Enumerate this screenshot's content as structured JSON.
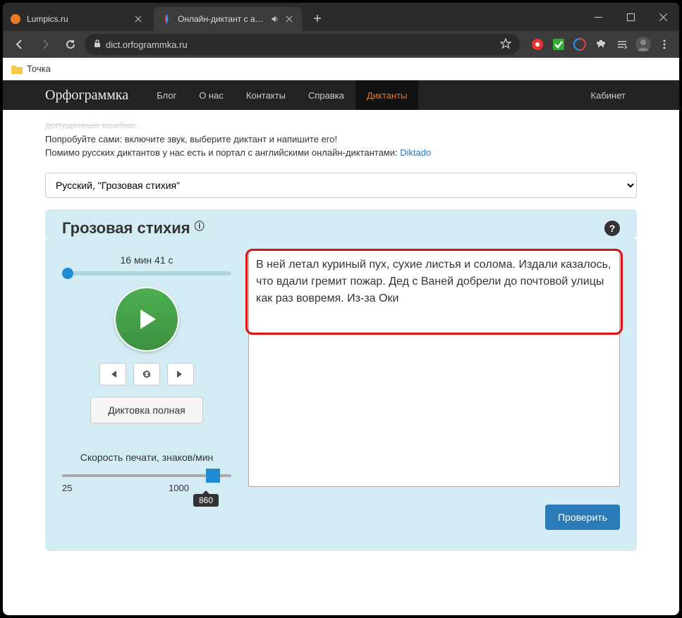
{
  "browser": {
    "tabs": [
      {
        "title": "Lumpics.ru",
        "active": false
      },
      {
        "title": "Онлайн-диктант с автомати",
        "active": true,
        "audio": true
      }
    ],
    "url": "dict.orfogrammka.ru",
    "bookmarks": [
      {
        "name": "Точка"
      }
    ]
  },
  "site": {
    "brand": "Орфограммка",
    "nav": [
      "Блог",
      "О нас",
      "Контакты",
      "Справка",
      "Диктанты"
    ],
    "nav_active": 4,
    "nav_right": "Кабинет"
  },
  "intro": {
    "line1": "допущенные ошибки.",
    "line2": "Попробуйте сами: включите звук, выберите диктант и напишите его!",
    "line3_pre": "Помимо русских диктантов у нас есть и портал с английскими онлайн-диктантами: ",
    "link": "Diktado"
  },
  "selector": "Русский, \"Грозовая стихия\"",
  "panel": {
    "title": "Грозовая стихия",
    "duration": "16 мин 41 с",
    "mode": "Диктовка полная",
    "speed_label": "Скорость печати, знаков/мин",
    "speed_min": "25",
    "speed_max": "1000",
    "speed_value": "860",
    "text": "В ней летал куриный пух, сухие листья и солома. Издали казалось, что вдали гремит пожар. Дед с Ваней добрели до почтовой улицы как раз вовремя. Из-за Оки",
    "check": "Проверить"
  }
}
